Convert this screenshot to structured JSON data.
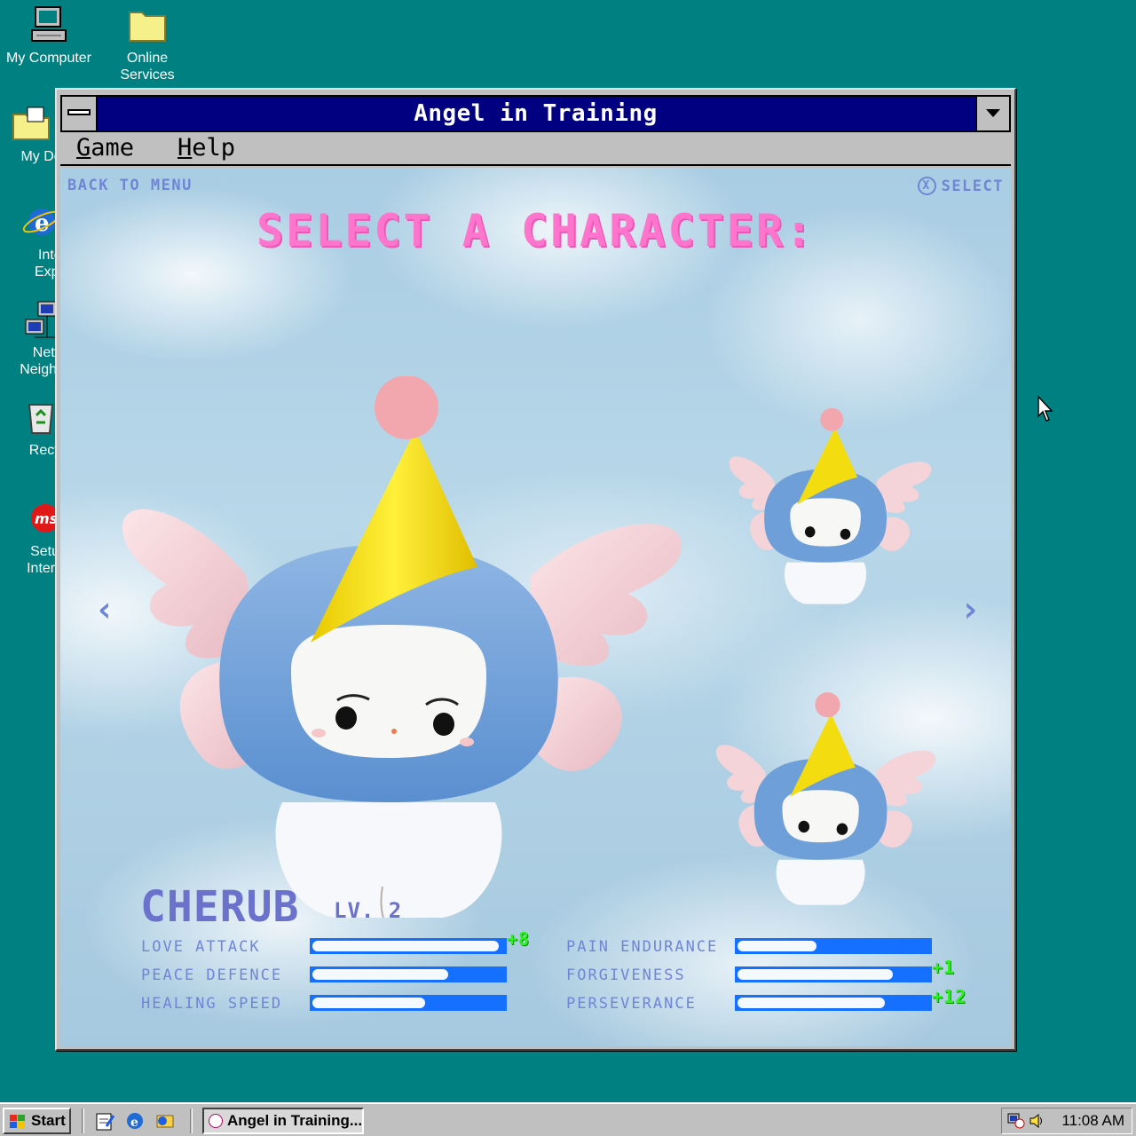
{
  "desktop": {
    "icons": [
      {
        "label_line1": "My Computer",
        "label_line2": "",
        "icon": "computer-icon"
      },
      {
        "label_line1": "Online",
        "label_line2": "Services",
        "icon": "folder-icon"
      },
      {
        "label_line1": "My Docu",
        "label_line2": "",
        "icon": "documents-folder-icon"
      },
      {
        "label_line1": "Inter",
        "label_line2": "Explo",
        "icon": "internet-explorer-icon"
      },
      {
        "label_line1": "Netw",
        "label_line2": "Neighbo",
        "icon": "network-icon"
      },
      {
        "label_line1": "Recyc",
        "label_line2": "",
        "icon": "recycle-bin-icon"
      },
      {
        "label_line1": "Setup",
        "label_line2": "Interne",
        "icon": "msn-icon"
      }
    ]
  },
  "window": {
    "title": "Angel in Training",
    "menu": {
      "game_first": "G",
      "game_rest": "ame",
      "help_first": "H",
      "help_rest": "elp"
    }
  },
  "game": {
    "back_label": "BACK TO MENU",
    "select_button": "X",
    "select_label": "SELECT",
    "heading": "SELECT A CHARACTER:",
    "prev_arrow": "‹",
    "next_arrow": "›",
    "character": {
      "name": "CHERUB",
      "level": "LV. 2"
    },
    "stats": [
      {
        "label": "LOVE ATTACK",
        "fill": 0.97,
        "bonus": "+8"
      },
      {
        "label": "PEACE DEFENCE",
        "fill": 0.71,
        "bonus": ""
      },
      {
        "label": "HEALING SPEED",
        "fill": 0.59,
        "bonus": ""
      },
      {
        "label": "PAIN ENDURANCE",
        "fill": 0.41,
        "bonus": ""
      },
      {
        "label": "FORGIVENESS",
        "fill": 0.81,
        "bonus": "+1"
      },
      {
        "label": "PERSEVERANCE",
        "fill": 0.77,
        "bonus": "+12"
      }
    ],
    "colors": {
      "heading": "#ff74cc",
      "ui_text": "#6f86d6",
      "bar": "#1570ff",
      "bonus": "#2cf21c"
    }
  },
  "taskbar": {
    "start_label": "Start",
    "task_label": "Angel in Training...",
    "clock": "11:08 AM"
  }
}
